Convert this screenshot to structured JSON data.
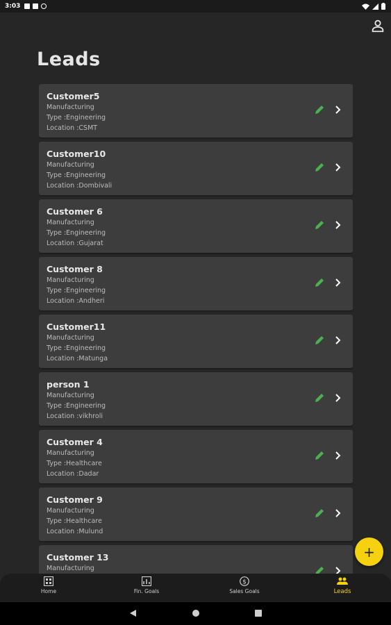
{
  "status_bar": {
    "time": "3:03"
  },
  "header": {
    "title": "Leads",
    "profile_icon": "person-icon"
  },
  "leads": [
    {
      "name": "Customer5",
      "category": "Manufacturing",
      "type": "Type :Engineering",
      "location": "Location :CSMT"
    },
    {
      "name": "Customer10",
      "category": "Manufacturing",
      "type": "Type :Engineering",
      "location": "Location :Dombivali"
    },
    {
      "name": "Customer 6",
      "category": "Manufacturing",
      "type": "Type :Engineering",
      "location": "Location :Gujarat"
    },
    {
      "name": "Customer 8",
      "category": "Manufacturing",
      "type": "Type :Engineering",
      "location": "Location :Andheri"
    },
    {
      "name": "Customer11",
      "category": "Manufacturing",
      "type": "Type :Engineering",
      "location": "Location :Matunga"
    },
    {
      "name": "person 1",
      "category": "Manufacturing",
      "type": "Type :Engineering",
      "location": "Location :vikhroli"
    },
    {
      "name": "Customer 4",
      "category": "Manufacturing",
      "type": "Type :Healthcare",
      "location": "Location :Dadar"
    },
    {
      "name": "Customer 9",
      "category": "Manufacturing",
      "type": "Type :Healthcare",
      "location": "Location :Mulund"
    },
    {
      "name": "Customer 13",
      "category": "Manufacturing",
      "type": "",
      "location": ""
    }
  ],
  "fab": {
    "label": "+"
  },
  "bottom_nav": {
    "items": [
      {
        "label": "Home",
        "icon": "dashboard-icon",
        "active": false
      },
      {
        "label": "Fin. Goals",
        "icon": "chart-icon",
        "active": false
      },
      {
        "label": "Sales Goals",
        "icon": "dollar-icon",
        "active": false
      },
      {
        "label": "Leads",
        "icon": "group-icon",
        "active": true
      }
    ]
  },
  "colors": {
    "background": "#262626",
    "card": "#3d3d3d",
    "accent": "#f5d10f",
    "edit": "#4caf50"
  }
}
